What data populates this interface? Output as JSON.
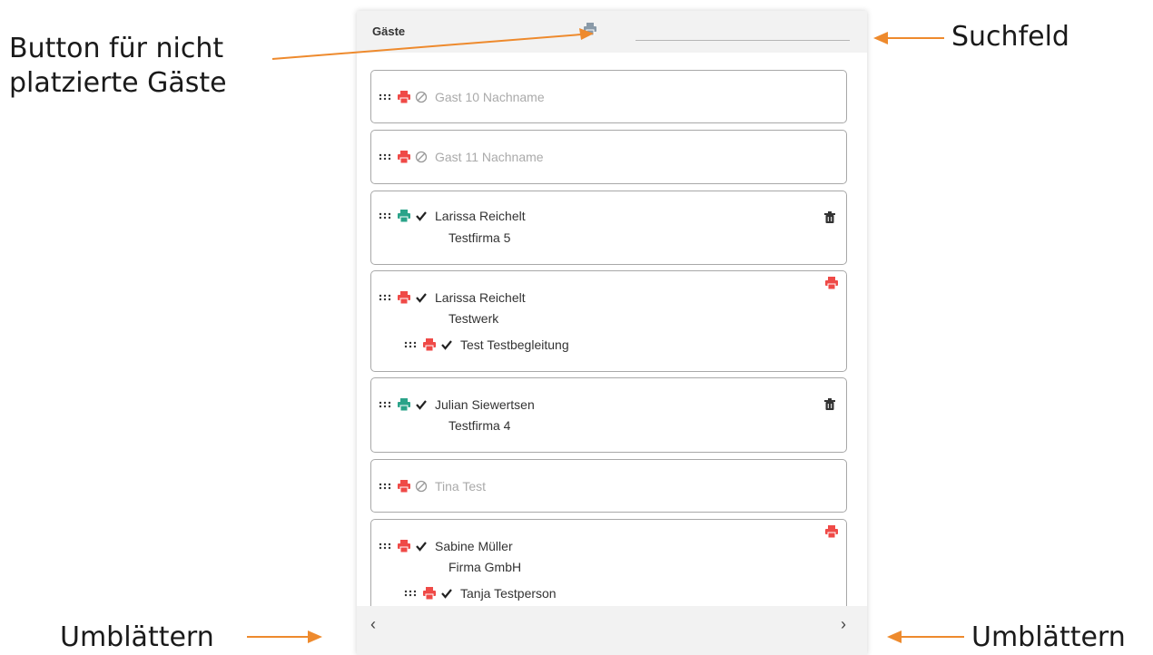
{
  "annotations": {
    "button_nicht_platziert_line1": "Button für nicht",
    "button_nicht_platziert_line2": "platzierte Gäste",
    "suchfeld": "Suchfeld",
    "umblaettern_left": "Umblättern",
    "umblaettern_right": "Umblättern"
  },
  "panel": {
    "title": "Gäste",
    "search": {
      "value": "",
      "placeholder": ""
    },
    "pagination": {
      "prev": "‹",
      "next": "›"
    }
  },
  "guests": [
    {
      "name": "Gast 10 Nachname",
      "placed": false,
      "print_status": "red"
    },
    {
      "name": "Gast 11 Nachname",
      "placed": false,
      "print_status": "red"
    },
    {
      "name": "Larissa Reichelt",
      "company": "Testfirma 5",
      "placed": true,
      "print_status": "green",
      "deletable": true
    },
    {
      "name": "Larissa Reichelt",
      "company": "Testwerk",
      "placed": true,
      "print_status": "red",
      "companion": {
        "name": "Test Testbegleitung",
        "placed": true,
        "print_status": "red"
      }
    },
    {
      "name": "Julian Siewertsen",
      "company": "Testfirma 4",
      "placed": true,
      "print_status": "green",
      "deletable": true
    },
    {
      "name": "Tina Test",
      "placed": false,
      "print_status": "red"
    },
    {
      "name": "Sabine Müller",
      "company": "Firma GmbH",
      "placed": true,
      "print_status": "red",
      "companion": {
        "name": "Tanja Testperson",
        "placed": true,
        "print_status": "red"
      }
    }
  ],
  "colors": {
    "accent": "#ee8a2d",
    "print_red": "#ef4a47",
    "print_green": "#2aa389",
    "print_grey": "#8a9aa8"
  }
}
